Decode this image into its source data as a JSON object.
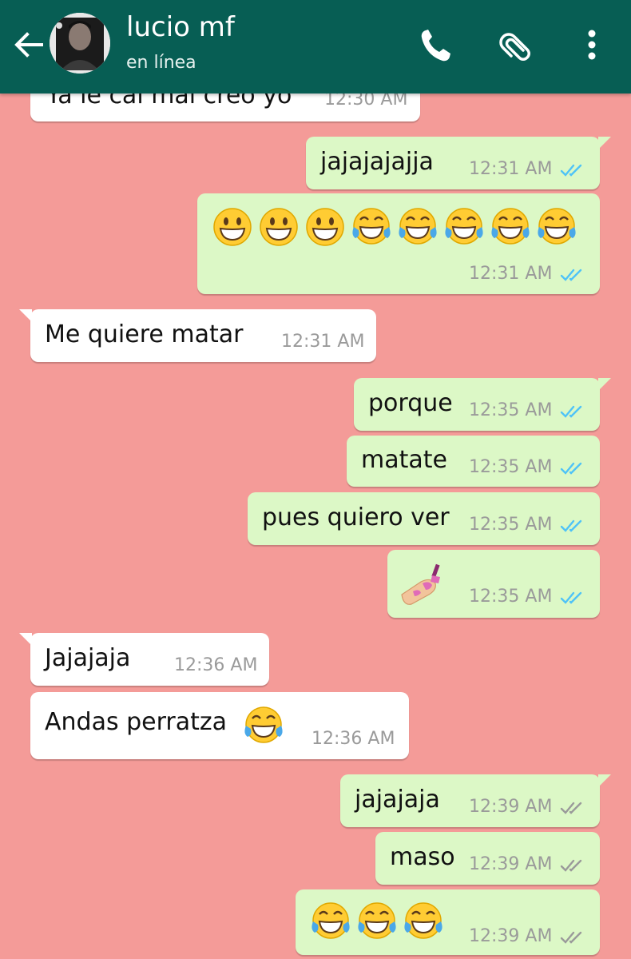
{
  "header": {
    "contact_name": "lucio mf",
    "status": "en línea"
  },
  "messages": [
    {
      "dir": "in",
      "text": "Ya le cai mal creo yo",
      "time": "12:30 AM"
    },
    {
      "dir": "out",
      "text": "jajajajajja",
      "time": "12:31 AM",
      "ticks": "read"
    },
    {
      "dir": "out",
      "emojis": [
        "grinning-face",
        "grinning-face",
        "grinning-face",
        "tears-of-joy",
        "tears-of-joy",
        "tears-of-joy",
        "tears-of-joy",
        "tears-of-joy"
      ],
      "time": "12:31 AM",
      "ticks": "read"
    },
    {
      "dir": "in",
      "text": "Me quiere matar",
      "time": "12:31 AM"
    },
    {
      "dir": "out",
      "text": "porque",
      "time": "12:35 AM",
      "ticks": "read"
    },
    {
      "dir": "out",
      "text": "matate",
      "time": "12:35 AM",
      "ticks": "read"
    },
    {
      "dir": "out",
      "text": "pues quiero ver",
      "time": "12:35 AM",
      "ticks": "read"
    },
    {
      "dir": "out",
      "emojis": [
        "nail-polish"
      ],
      "time": "12:35 AM",
      "ticks": "read"
    },
    {
      "dir": "in",
      "text": "Jajajaja",
      "time": "12:36 AM"
    },
    {
      "dir": "in",
      "text": "Andas perratza",
      "emojis": [
        "tears-of-joy"
      ],
      "time": "12:36 AM"
    },
    {
      "dir": "out",
      "text": "jajajaja",
      "time": "12:39 AM",
      "ticks": "delivered"
    },
    {
      "dir": "out",
      "text": "maso",
      "time": "12:39 AM",
      "ticks": "delivered"
    },
    {
      "dir": "out",
      "emojis": [
        "tears-of-joy",
        "tears-of-joy",
        "tears-of-joy"
      ],
      "time": "12:39 AM",
      "ticks": "delivered"
    }
  ],
  "colors": {
    "header": "#075e54",
    "chat_background": "#f49b98",
    "outgoing_bubble": "#dcf8c6",
    "incoming_bubble": "#ffffff",
    "read_ticks": "#4fc3f7",
    "delivered_ticks": "#9a9a9a"
  }
}
